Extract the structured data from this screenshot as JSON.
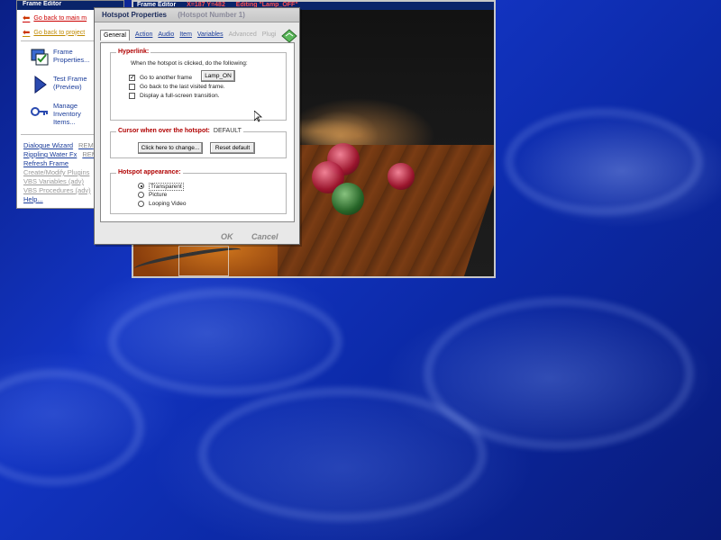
{
  "side_panel": {
    "title": "Frame Editor",
    "back_links": [
      "Go back to main m",
      "Go back to project"
    ],
    "items": [
      {
        "label": "Frame Properties...",
        "icon": "frame-properties-icon"
      },
      {
        "label": "Test Frame (Preview)",
        "icon": "play-triangle-icon"
      },
      {
        "label": "Manage Inventory Items...",
        "icon": "keys-icon"
      }
    ],
    "links": [
      {
        "text": "Dialogue Wizard",
        "tail": "REM",
        "gray": false
      },
      {
        "text": "Rippling Water Fx",
        "tail": "REM",
        "gray": false
      },
      {
        "text": "Refresh Frame",
        "tail": "",
        "gray": false
      },
      {
        "text": "Create/Modify Plugins",
        "tail": "",
        "gray": true
      },
      {
        "text": "VBS Variables (adv)",
        "tail": "",
        "gray": true
      },
      {
        "text": "VBS Procedures (adv)",
        "tail": "",
        "gray": true
      },
      {
        "text": "Help...",
        "tail": "",
        "gray": false
      }
    ]
  },
  "image_window": {
    "title": "Frame Editor",
    "coords": "X=187 Y=482",
    "editing": "Editing \"Lamp_OFF\""
  },
  "dialog": {
    "title": "Hotspot Properties",
    "subtitle": "(Hotspot Number 1)",
    "tabs": [
      {
        "label": "General",
        "state": "active"
      },
      {
        "label": "Action",
        "state": "normal"
      },
      {
        "label": "Audio",
        "state": "normal"
      },
      {
        "label": "Item",
        "state": "normal"
      },
      {
        "label": "Variables",
        "state": "normal"
      },
      {
        "label": "Advanced",
        "state": "disabled"
      },
      {
        "label": "Plugi",
        "state": "disabled"
      }
    ],
    "hyperlink": {
      "title": "Hyperlink:",
      "instruction": "When the hotspot is clicked, do the following:",
      "options": [
        {
          "label": "Go to another frame",
          "checked": true
        },
        {
          "label": "Go back to the last visited frame.",
          "checked": false
        },
        {
          "label": "Display a full-screen transition.",
          "checked": false
        }
      ],
      "frame_button": "Lamp_ON"
    },
    "cursor": {
      "title": "Cursor when over the hotspot:",
      "value": "DEFAULT",
      "change_button": "Click here to change...",
      "reset_button": "Reset default"
    },
    "appearance": {
      "title": "Hotspot appearance:",
      "options": [
        {
          "label": "Transparent",
          "selected": true
        },
        {
          "label": "Picture",
          "selected": false
        },
        {
          "label": "Looping Video",
          "selected": false
        }
      ]
    },
    "ok_label": "OK",
    "cancel_label": "Cancel"
  }
}
